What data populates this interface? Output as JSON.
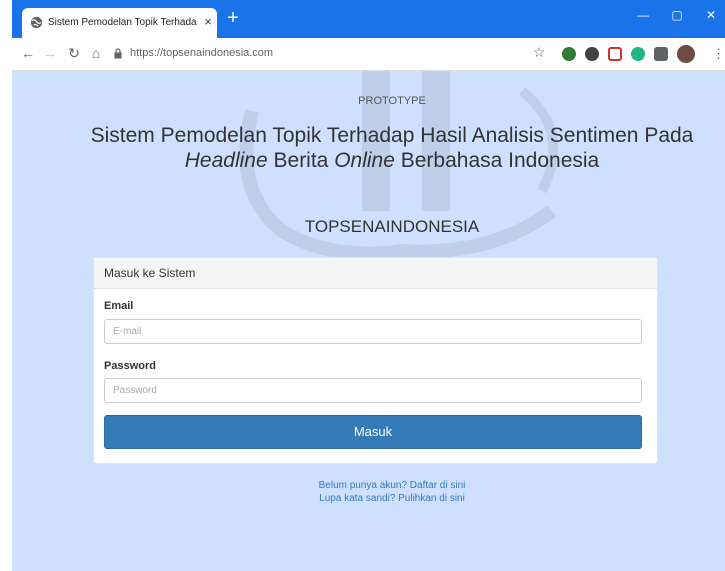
{
  "browser": {
    "tab_title": "Sistem Pemodelan Topik Terhada",
    "tab_close": "×",
    "new_tab": "+",
    "url": "https://topsenaindonesia.com",
    "window_controls": {
      "minimize": "—",
      "maximize": "▢",
      "close": "✕"
    },
    "accent": "#1a73e8"
  },
  "page": {
    "tagline": "PROTOTYPE",
    "title": {
      "part1": "Sistem Pemodelan Topik Terhadap Hasil Analisis Sentimen Pada ",
      "em1": "Headline",
      "part2": " Berita ",
      "em2": "Online",
      "part3": " Berbahasa Indonesia"
    },
    "brand": "TOPSENAINDONESIA",
    "background": "#cfe0ff"
  },
  "login": {
    "heading": "Masuk ke Sistem",
    "email_label": "Email",
    "email_placeholder": "E-mail",
    "password_label": "Password",
    "password_placeholder": "Password",
    "submit_label": "Masuk",
    "button_color": "#337ab7"
  },
  "links": {
    "register": "Belum punya akun? Daftar di sini",
    "forgot": "Lupa kata sandi? Pulihkan di sini"
  }
}
